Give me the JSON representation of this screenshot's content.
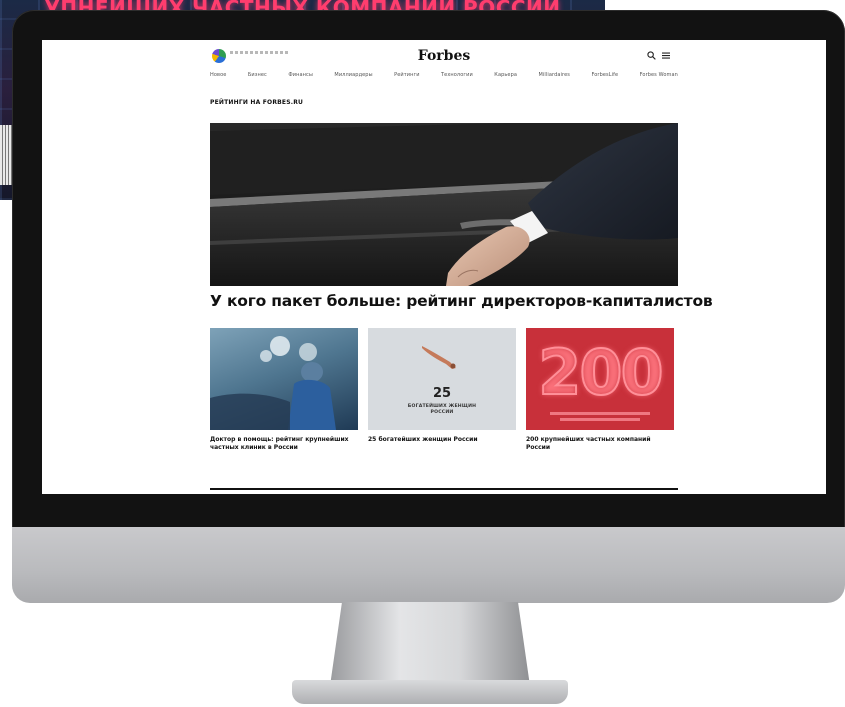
{
  "background": {
    "poster_title": "УПНЕЙШИХ ЧАСТНЫХ КОМПАНИЙ РОССИИ"
  },
  "site": {
    "logo_icon": "forbes-multicolor-logo-mark",
    "brand": "Forbes",
    "nav": [
      "Новое",
      "Бизнес",
      "Финансы",
      "Миллиардеры",
      "Рейтинги",
      "Технологии",
      "Карьера",
      "Milliardaires",
      "ForbesLife",
      "Forbes Woman"
    ],
    "section_label": "РЕЙТИНГИ НА FORBES.RU",
    "hero": {
      "title": "У кого пакет больше: рейтинг директоров-капиталистов"
    },
    "cards": [
      {
        "caption": "Доктор в помощь: рейтинг крупнейших частных клиник в России"
      },
      {
        "count": "25",
        "subtitle_line1": "БОГАТЕЙШИХ ЖЕНЩИН",
        "subtitle_line2": "РОССИИ",
        "caption": "25 богатейших женщин России"
      },
      {
        "number": "200",
        "caption": "200 крупнейших частных компаний России"
      }
    ]
  },
  "colors": {
    "poster_accent": "#ff3d6e",
    "card3_bg": "#c8303a",
    "text": "#111111"
  }
}
